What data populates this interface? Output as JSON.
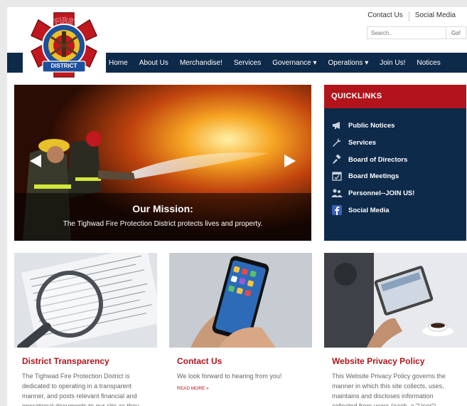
{
  "header": {
    "links": [
      "Contact Us",
      "Social Media"
    ],
    "search": {
      "placeholder": "Search..",
      "button": "Go!"
    },
    "logo": {
      "top_text": "FIRE",
      "bottom_text": "DISTRICT"
    }
  },
  "nav": {
    "items": [
      {
        "label": "Home"
      },
      {
        "label": "About Us"
      },
      {
        "label": "Merchandise!"
      },
      {
        "label": "Services"
      },
      {
        "label": "Governance ▾"
      },
      {
        "label": "Operations ▾"
      },
      {
        "label": "Join Us!"
      },
      {
        "label": "Notices"
      }
    ]
  },
  "hero": {
    "title": "Our Mission:",
    "subtitle": "The Tighwad Fire Protection District protects lives and property."
  },
  "quicklinks": {
    "title": "QUICKLINKS",
    "items": [
      {
        "label": "Public Notices",
        "icon": "megaphone-icon"
      },
      {
        "label": "Services",
        "icon": "wrench-icon"
      },
      {
        "label": "Board of Directors",
        "icon": "gavel-icon"
      },
      {
        "label": "Board Meetings",
        "icon": "calendar-check-icon"
      },
      {
        "label": "Personnel--JOIN US!",
        "icon": "users-icon"
      },
      {
        "label": "Social Media",
        "icon": "facebook-icon"
      }
    ]
  },
  "cards": [
    {
      "title": "District Transparency",
      "text": "The Tighwad Fire Protection District is dedicated to operating in a transparent manner, and posts relevant financial and operational documents to our site as they",
      "more": ""
    },
    {
      "title": "Contact Us",
      "text": "We look forward to hearing from you!",
      "more": "READ MORE »"
    },
    {
      "title": "Website Privacy Policy",
      "text": "This Website Privacy Policy governs the manner in which this site collects, uses, maintains and discloses information collected from users (each, a \"User\")",
      "more": ""
    }
  ],
  "colors": {
    "navy": "#0e2a4a",
    "red": "#b3141c"
  }
}
